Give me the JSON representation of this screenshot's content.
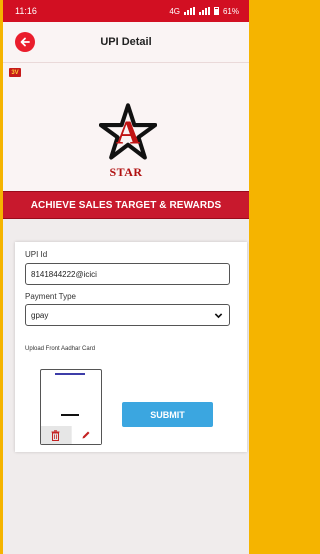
{
  "status_bar": {
    "time": "11:16",
    "network": "4G",
    "battery": "61%"
  },
  "header": {
    "title": "UPI Detail"
  },
  "logo": {
    "corner_mark": "3V",
    "star_letter": "A",
    "brand": "STAR"
  },
  "banner": {
    "text": "ACHIEVE SALES TARGET & REWARDS"
  },
  "form": {
    "upi_label": "UPI Id",
    "upi_value": "8141844222@icici",
    "payment_label": "Payment Type",
    "payment_value": "gpay",
    "upload_label": "Upload Front Aadhar Card",
    "submit_label": "SUBMIT"
  },
  "colors": {
    "brand_red": "#d20f22",
    "banner_red": "#c8192d",
    "submit_blue": "#3ba6e0",
    "frame_yellow": "#f5b400"
  }
}
